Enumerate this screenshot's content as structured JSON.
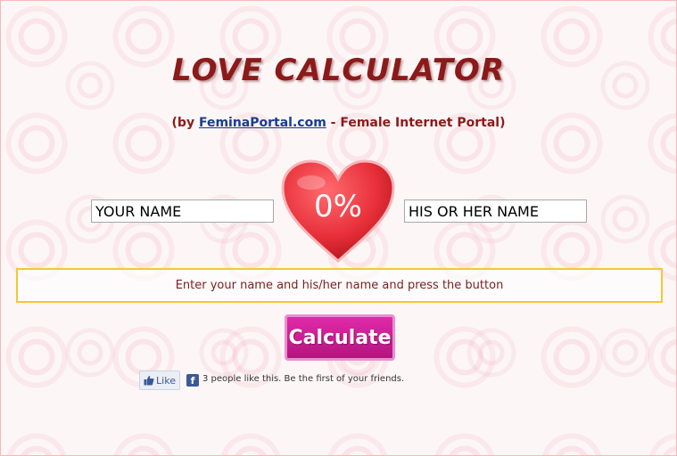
{
  "title": "LOVE CALCULATOR",
  "byline": {
    "prefix": "(by ",
    "link": "FeminaPortal.com",
    "suffix": " - Female Internet Portal)"
  },
  "inputs": {
    "your_name": "YOUR NAME",
    "their_name": "HIS OR HER NAME"
  },
  "heart": {
    "percent": "0%",
    "color": "#e8303a"
  },
  "message": "Enter your name and his/her name and press the button",
  "calculate_label": "Calculate",
  "facebook": {
    "like_label": "Like",
    "like_icon": "thumbs-up-icon",
    "brand_icon": "facebook-icon",
    "brand_glyph": "f",
    "count_text": "3 people like this. Be the first of your friends."
  },
  "colors": {
    "title": "#8b1a1a",
    "button": "#c41c91",
    "message_border": "#f2c933"
  }
}
